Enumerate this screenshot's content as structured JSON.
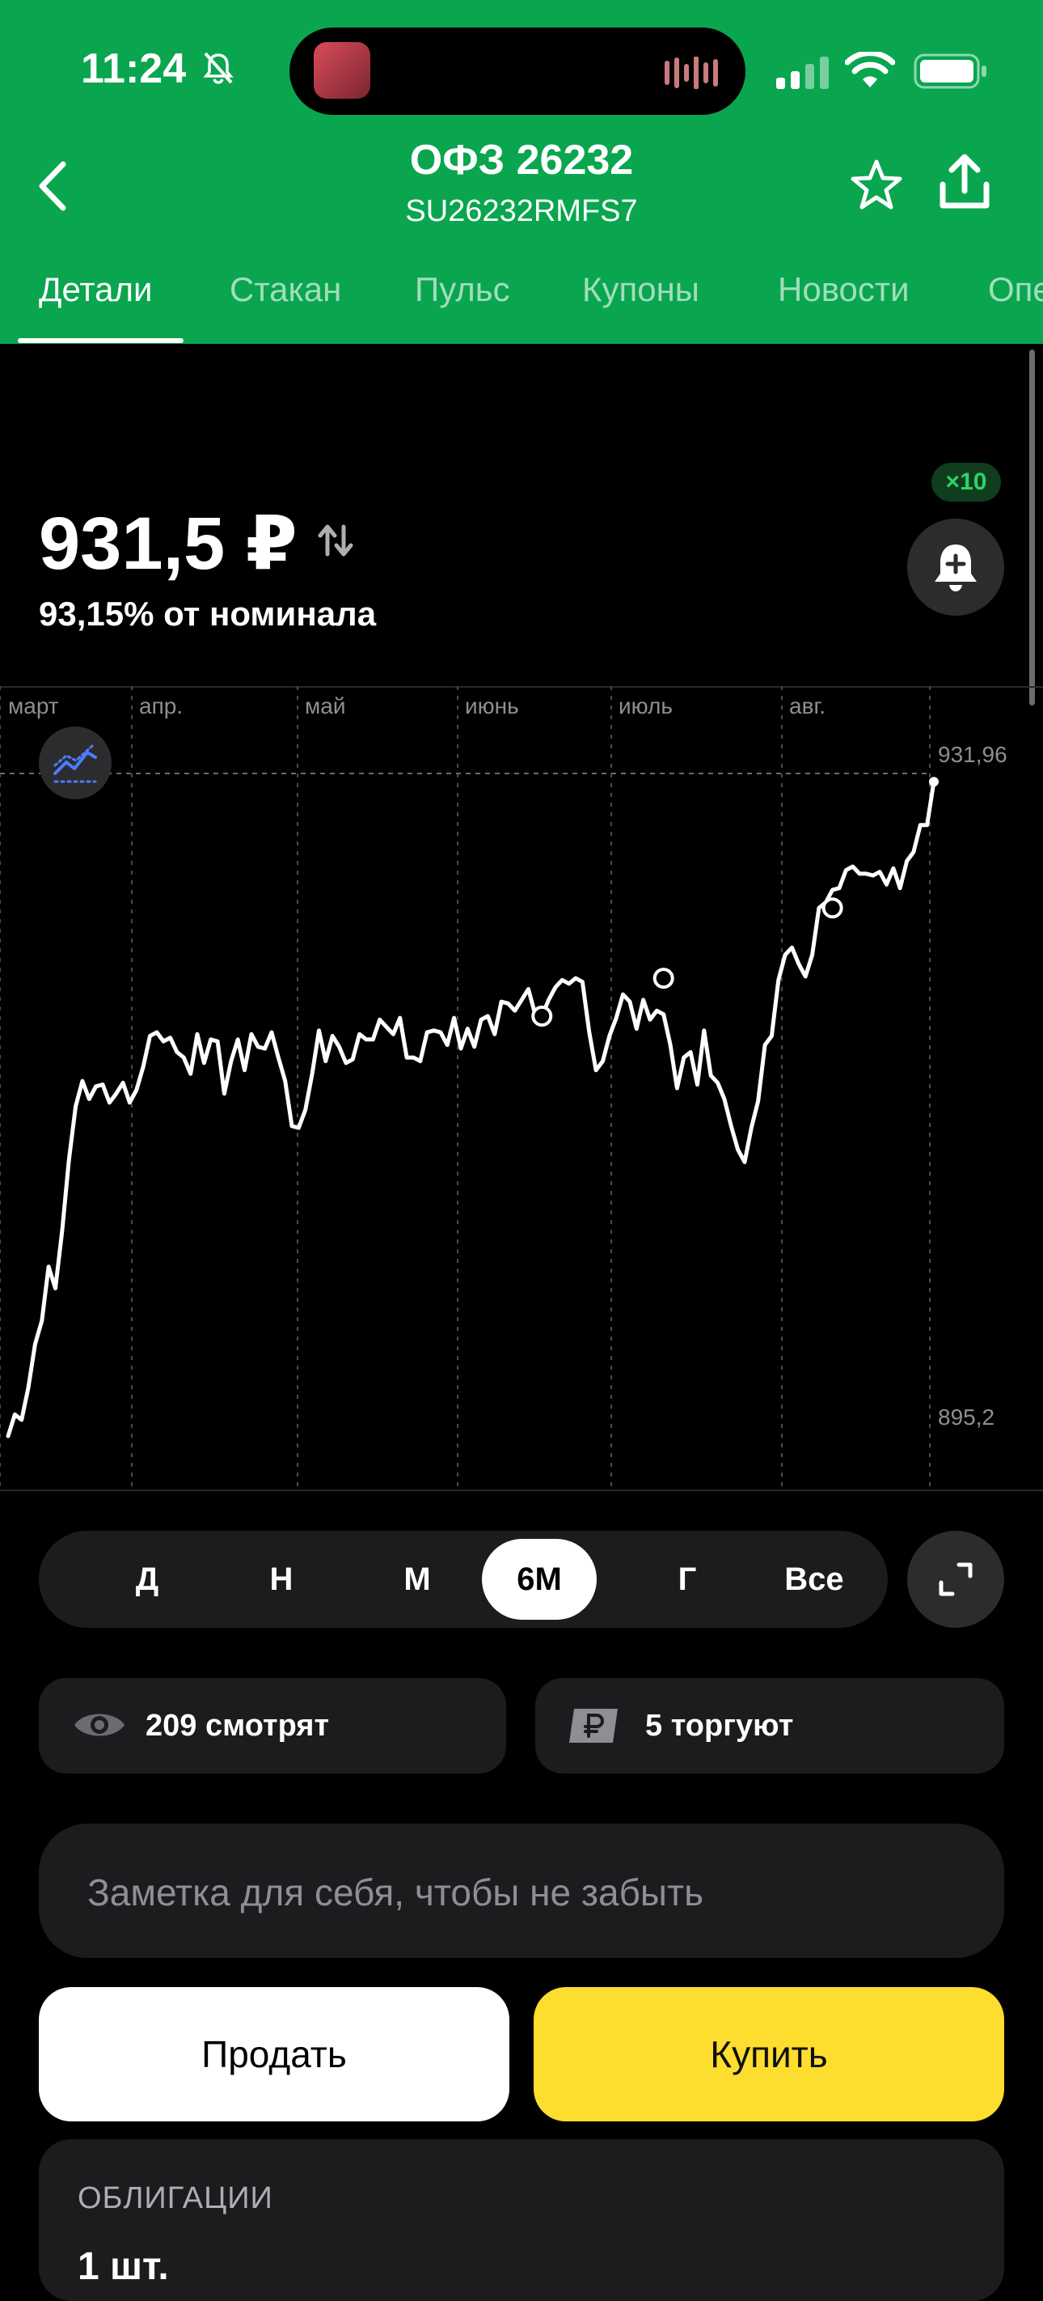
{
  "status_bar": {
    "time": "11:24"
  },
  "header": {
    "title": "ОФЗ 26232",
    "subtitle": "SU26232RMFS7",
    "tabs": [
      {
        "label": "Детали",
        "active": true
      },
      {
        "label": "Стакан"
      },
      {
        "label": "Пульс"
      },
      {
        "label": "Купоны"
      },
      {
        "label": "Новости"
      },
      {
        "label": "Опе"
      }
    ]
  },
  "quote": {
    "price": "931,5 ₽",
    "nominal_text": "93,15% от номинала",
    "alert_badge": "×10"
  },
  "chart_data": {
    "type": "line",
    "x_ticks": [
      "март",
      "апр.",
      "май",
      "июнь",
      "июль",
      "авг."
    ],
    "y_tick_labels": [
      "931,96",
      "895,2"
    ],
    "ylim": [
      895.2,
      931.96
    ],
    "grid": true,
    "values": [
      895.2,
      896.4,
      896.1,
      897.9,
      900.3,
      901.6,
      904.6,
      903.4,
      906.6,
      910.5,
      913.5,
      914.9,
      913.9,
      914.6,
      914.7,
      913.7,
      914.2,
      914.8,
      913.7,
      914.4,
      915.7,
      917.4,
      917.6,
      917.1,
      917.3,
      916.5,
      916.2,
      915.3,
      917.5,
      915.9,
      917.2,
      917.1,
      914.2,
      916.0,
      917.2,
      915.5,
      917.5,
      916.8,
      916.7,
      917.6,
      916.2,
      914.9,
      912.4,
      912.3,
      913.3,
      915.3,
      917.7,
      916.0,
      917.4,
      916.8,
      915.9,
      916.1,
      917.5,
      917.2,
      917.2,
      918.3,
      917.9,
      917.5,
      918.4,
      916.2,
      916.2,
      916.0,
      917.6,
      917.7,
      917.6,
      916.9,
      918.4,
      916.7,
      917.8,
      916.8,
      918.3,
      918.5,
      917.5,
      919.3,
      919.2,
      918.8,
      919.4,
      920.0,
      918.6,
      918.5,
      919.4,
      920.1,
      920.5,
      920.3,
      920.6,
      920.4,
      917.6,
      915.5,
      916.0,
      917.4,
      918.4,
      919.7,
      919.3,
      917.8,
      919.4,
      918.3,
      918.8,
      918.6,
      916.9,
      914.5,
      916.2,
      916.5,
      914.7,
      917.7,
      915.2,
      914.8,
      913.9,
      912.4,
      911.1,
      910.4,
      912.3,
      913.8,
      916.9,
      917.4,
      920.5,
      921.9,
      922.3,
      921.4,
      920.7,
      921.9,
      924.5,
      924.8,
      925.5,
      925.6,
      926.6,
      926.8,
      926.4,
      926.4,
      926.3,
      926.5,
      925.8,
      926.7,
      925.6,
      927.1,
      927.6,
      929.1,
      929.1,
      931.5
    ],
    "markers": [
      {
        "x_index": 79,
        "y": 918.5
      },
      {
        "x_index": 97,
        "y": 920.6
      },
      {
        "x_index": 122,
        "y": 924.5
      }
    ],
    "current_price": 931.5
  },
  "periods": [
    "Д",
    "Н",
    "М",
    "6М",
    "Г",
    "Все"
  ],
  "selected_period": "6М",
  "stats": {
    "watching": "209 смотрят",
    "trading": "5 торгуют"
  },
  "note_placeholder": "Заметка для себя, чтобы не забыть",
  "actions": {
    "sell": "Продать",
    "buy": "Купить"
  },
  "holdings": {
    "label": "ОБЛИГАЦИИ",
    "value": "1 шт."
  },
  "colors": {
    "header_green": "#09a64f",
    "buy_yellow": "#fddd2d",
    "badge_green": "#2fd266"
  }
}
